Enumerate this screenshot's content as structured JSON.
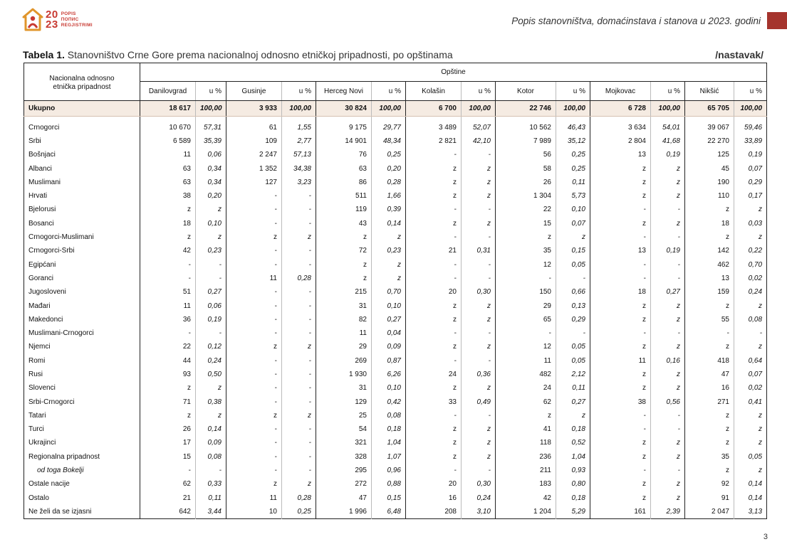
{
  "logo": {
    "year_top": "20",
    "year_bottom": "23",
    "words": [
      "POPIS",
      "ПОПИС",
      "REGJISTRIMI"
    ]
  },
  "header": {
    "title": "Popis stanovništva, domaćinstava i stanova u 2023. godini",
    "accent_color": "#a5342d"
  },
  "table": {
    "caption_label": "Tabela 1.",
    "caption_text": "Stanovništvo Crne Gore prema nacionalnoj odnosno etničkoj pripadnosti, po opštinama",
    "continued": "/nastavak/",
    "row_header_line1": "Nacionalna odnosno",
    "row_header_line2": "etnička pripadnost",
    "group_header": "Opštine",
    "pct_label": "u %",
    "municipalities": [
      "Danilovgrad",
      "Gusinje",
      "Herceg Novi",
      "Kolašin",
      "Kotor",
      "Mojkovac",
      "Nikšić"
    ],
    "total_row": {
      "label": "Ukupno",
      "cells": [
        "18 617",
        "100,00",
        "3 933",
        "100,00",
        "30 824",
        "100,00",
        "6 700",
        "100,00",
        "22 746",
        "100,00",
        "6 728",
        "100,00",
        "65 705",
        "100,00"
      ]
    },
    "rows": [
      {
        "label": "Crnogorci",
        "cells": [
          "10 670",
          "57,31",
          "61",
          "1,55",
          "9 175",
          "29,77",
          "3 489",
          "52,07",
          "10 562",
          "46,43",
          "3 634",
          "54,01",
          "39 067",
          "59,46"
        ]
      },
      {
        "label": "Srbi",
        "cells": [
          "6 589",
          "35,39",
          "109",
          "2,77",
          "14 901",
          "48,34",
          "2 821",
          "42,10",
          "7 989",
          "35,12",
          "2 804",
          "41,68",
          "22 270",
          "33,89"
        ]
      },
      {
        "label": "Bošnjaci",
        "cells": [
          "11",
          "0,06",
          "2 247",
          "57,13",
          "76",
          "0,25",
          "-",
          "-",
          "56",
          "0,25",
          "13",
          "0,19",
          "125",
          "0,19"
        ]
      },
      {
        "label": "Albanci",
        "cells": [
          "63",
          "0,34",
          "1 352",
          "34,38",
          "63",
          "0,20",
          "z",
          "z",
          "58",
          "0,25",
          "z",
          "z",
          "45",
          "0,07"
        ]
      },
      {
        "label": "Muslimani",
        "cells": [
          "63",
          "0,34",
          "127",
          "3,23",
          "86",
          "0,28",
          "z",
          "z",
          "26",
          "0,11",
          "z",
          "z",
          "190",
          "0,29"
        ]
      },
      {
        "label": "Hrvati",
        "cells": [
          "38",
          "0,20",
          "-",
          "-",
          "511",
          "1,66",
          "z",
          "z",
          "1 304",
          "5,73",
          "z",
          "z",
          "110",
          "0,17"
        ]
      },
      {
        "label": "Bjelorusi",
        "cells": [
          "z",
          "z",
          "-",
          "-",
          "119",
          "0,39",
          "-",
          "-",
          "22",
          "0,10",
          "-",
          "-",
          "z",
          "z"
        ]
      },
      {
        "label": "Bosanci",
        "cells": [
          "18",
          "0,10",
          "-",
          "-",
          "43",
          "0,14",
          "z",
          "z",
          "15",
          "0,07",
          "z",
          "z",
          "18",
          "0,03"
        ]
      },
      {
        "label": "Crnogorci-Muslimani",
        "cells": [
          "z",
          "z",
          "z",
          "z",
          "z",
          "z",
          "-",
          "-",
          "z",
          "z",
          "-",
          "-",
          "z",
          "z"
        ]
      },
      {
        "label": "Crnogorci-Srbi",
        "cells": [
          "42",
          "0,23",
          "-",
          "-",
          "72",
          "0,23",
          "21",
          "0,31",
          "35",
          "0,15",
          "13",
          "0,19",
          "142",
          "0,22"
        ]
      },
      {
        "label": "Egipćani",
        "cells": [
          "-",
          "-",
          "-",
          "-",
          "z",
          "z",
          "-",
          "-",
          "12",
          "0,05",
          "-",
          "-",
          "462",
          "0,70"
        ]
      },
      {
        "label": "Goranci",
        "cells": [
          "-",
          "-",
          "11",
          "0,28",
          "z",
          "z",
          "-",
          "-",
          "-",
          "-",
          "-",
          "-",
          "13",
          "0,02"
        ]
      },
      {
        "label": "Jugosloveni",
        "cells": [
          "51",
          "0,27",
          "-",
          "-",
          "215",
          "0,70",
          "20",
          "0,30",
          "150",
          "0,66",
          "18",
          "0,27",
          "159",
          "0,24"
        ]
      },
      {
        "label": "Mađari",
        "cells": [
          "11",
          "0,06",
          "-",
          "-",
          "31",
          "0,10",
          "z",
          "z",
          "29",
          "0,13",
          "z",
          "z",
          "z",
          "z"
        ]
      },
      {
        "label": "Makedonci",
        "cells": [
          "36",
          "0,19",
          "-",
          "-",
          "82",
          "0,27",
          "z",
          "z",
          "65",
          "0,29",
          "z",
          "z",
          "55",
          "0,08"
        ]
      },
      {
        "label": "Muslimani-Crnogorci",
        "cells": [
          "-",
          "-",
          "-",
          "-",
          "11",
          "0,04",
          "-",
          "-",
          "-",
          "-",
          "-",
          "-",
          "-",
          "-"
        ]
      },
      {
        "label": "Njemci",
        "cells": [
          "22",
          "0,12",
          "z",
          "z",
          "29",
          "0,09",
          "z",
          "z",
          "12",
          "0,05",
          "z",
          "z",
          "z",
          "z"
        ]
      },
      {
        "label": "Romi",
        "cells": [
          "44",
          "0,24",
          "-",
          "-",
          "269",
          "0,87",
          "-",
          "-",
          "11",
          "0,05",
          "11",
          "0,16",
          "418",
          "0,64"
        ]
      },
      {
        "label": "Rusi",
        "cells": [
          "93",
          "0,50",
          "-",
          "-",
          "1 930",
          "6,26",
          "24",
          "0,36",
          "482",
          "2,12",
          "z",
          "z",
          "47",
          "0,07"
        ]
      },
      {
        "label": "Slovenci",
        "cells": [
          "z",
          "z",
          "-",
          "-",
          "31",
          "0,10",
          "z",
          "z",
          "24",
          "0,11",
          "z",
          "z",
          "16",
          "0,02"
        ]
      },
      {
        "label": "Srbi-Crnogorci",
        "cells": [
          "71",
          "0,38",
          "-",
          "-",
          "129",
          "0,42",
          "33",
          "0,49",
          "62",
          "0,27",
          "38",
          "0,56",
          "271",
          "0,41"
        ]
      },
      {
        "label": "Tatari",
        "cells": [
          "z",
          "z",
          "z",
          "z",
          "25",
          "0,08",
          "-",
          "-",
          "z",
          "z",
          "-",
          "-",
          "z",
          "z"
        ]
      },
      {
        "label": "Turci",
        "cells": [
          "26",
          "0,14",
          "-",
          "-",
          "54",
          "0,18",
          "z",
          "z",
          "41",
          "0,18",
          "-",
          "-",
          "z",
          "z"
        ]
      },
      {
        "label": "Ukrajinci",
        "cells": [
          "17",
          "0,09",
          "-",
          "-",
          "321",
          "1,04",
          "z",
          "z",
          "118",
          "0,52",
          "z",
          "z",
          "z",
          "z"
        ]
      },
      {
        "label": "Regionalna pripadnost",
        "cells": [
          "15",
          "0,08",
          "-",
          "-",
          "328",
          "1,07",
          "z",
          "z",
          "236",
          "1,04",
          "z",
          "z",
          "35",
          "0,05"
        ]
      },
      {
        "label": "od toga Bokelji",
        "sub": true,
        "cells": [
          "-",
          "-",
          "-",
          "-",
          "295",
          "0,96",
          "-",
          "-",
          "211",
          "0,93",
          "-",
          "-",
          "z",
          "z"
        ]
      },
      {
        "label": "Ostale nacije",
        "cells": [
          "62",
          "0,33",
          "z",
          "z",
          "272",
          "0,88",
          "20",
          "0,30",
          "183",
          "0,80",
          "z",
          "z",
          "92",
          "0,14"
        ]
      },
      {
        "label": "Ostalo",
        "cells": [
          "21",
          "0,11",
          "11",
          "0,28",
          "47",
          "0,15",
          "16",
          "0,24",
          "42",
          "0,18",
          "z",
          "z",
          "91",
          "0,14"
        ]
      },
      {
        "label": "Ne želi da se izjasni",
        "cells": [
          "642",
          "3,44",
          "10",
          "0,25",
          "1 996",
          "6,48",
          "208",
          "3,10",
          "1 204",
          "5,29",
          "161",
          "2,39",
          "2 047",
          "3,13"
        ]
      }
    ]
  },
  "page_number": "3"
}
